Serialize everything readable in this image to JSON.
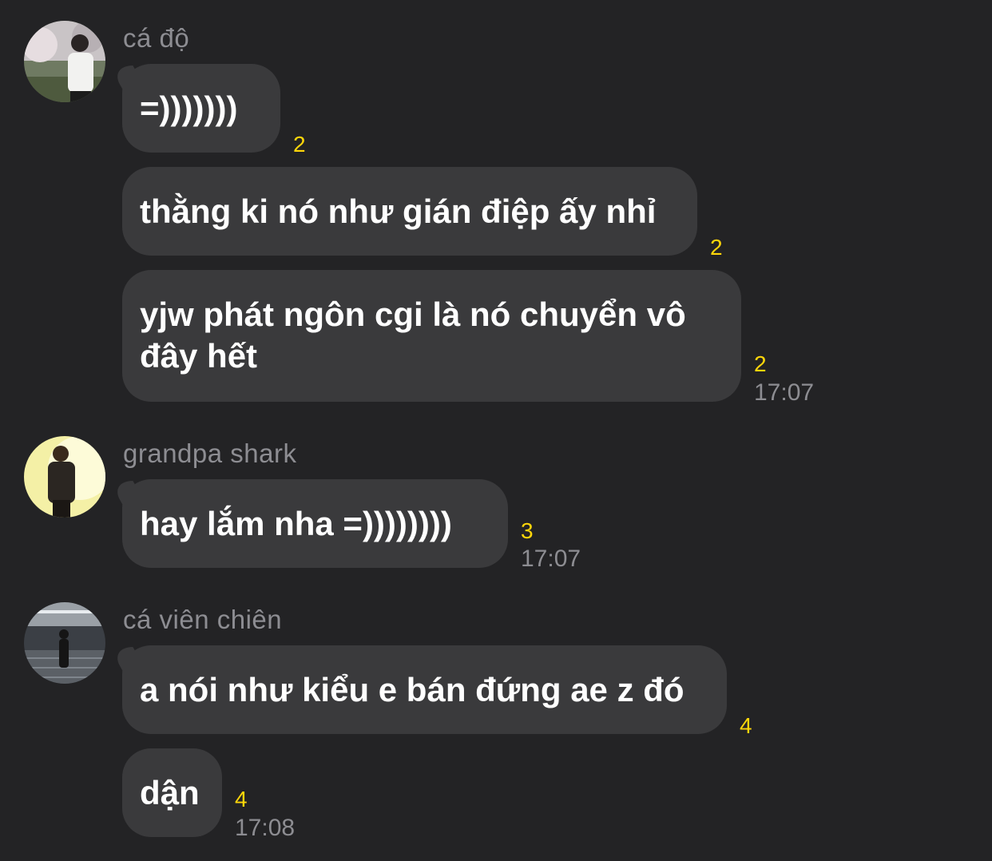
{
  "groups": [
    {
      "sender": "cá độ",
      "avatar": "avatar-photo",
      "messages": [
        {
          "text": "=)))))))",
          "count": "2"
        },
        {
          "text": "thằng ki nó như gián điệp ấy nhỉ",
          "count": "2"
        },
        {
          "text_line1": "yjw phát ngôn cgi là nó chuyển vô",
          "text_line2": "đây hết",
          "count": "2",
          "time": "17:07"
        }
      ]
    },
    {
      "sender": "grandpa shark",
      "avatar": "avatar-photo",
      "messages": [
        {
          "text": "hay lắm nha =))))))))",
          "count": "3",
          "time": "17:07"
        }
      ]
    },
    {
      "sender": "cá viên chiên",
      "avatar": "avatar-photo",
      "messages": [
        {
          "text": "a nói như kiểu e bán đứng ae z đó",
          "count": "4"
        },
        {
          "text": "dận",
          "count": "4",
          "time": "17:08"
        }
      ]
    }
  ],
  "colors": {
    "background": "#232325",
    "bubble": "#3a3a3c",
    "count": "#ffd60a",
    "secondary_text": "#8d8d92"
  }
}
